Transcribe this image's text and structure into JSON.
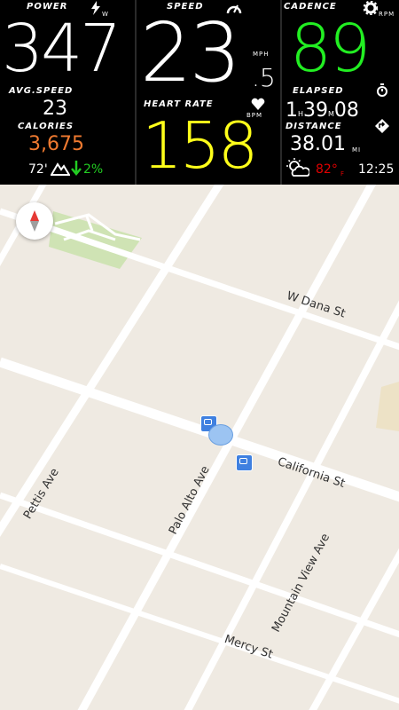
{
  "dashboard": {
    "power": {
      "label": "POWER",
      "value": "347",
      "unit": "W"
    },
    "speed": {
      "label": "SPEED",
      "value": "23",
      "decimal": ".5",
      "unit": "MPH"
    },
    "cadence": {
      "label": "CADENCE",
      "value": "89",
      "unit": "RPM"
    },
    "avg_speed": {
      "label": "AVG.SPEED",
      "value": "23"
    },
    "calories": {
      "label": "CALORIES",
      "value": "3,675"
    },
    "heart_rate": {
      "label": "HEART RATE",
      "value": "158",
      "unit": "BPM"
    },
    "elapsed": {
      "label": "ELAPSED",
      "hours": "1",
      "h": "H",
      "minutes": "39",
      "m": "M",
      "seconds": "08"
    },
    "distance": {
      "label": "DISTANCE",
      "value": "38.01",
      "unit": "MI"
    },
    "elevation": "72'",
    "grade": "2%",
    "temperature": "82°",
    "temperature_unit": "F",
    "clock": "12:25"
  },
  "map": {
    "streets": [
      "W Dana St",
      "California St",
      "Pettis Ave",
      "Palo Alto Ave",
      "Mountain View Ave",
      "Mercy St"
    ]
  },
  "colors": {
    "cadence": "#22ee22",
    "calories": "#f07a30",
    "heart_rate": "#ffff1a",
    "grade": "#22cc22",
    "temperature": "#e00000"
  }
}
